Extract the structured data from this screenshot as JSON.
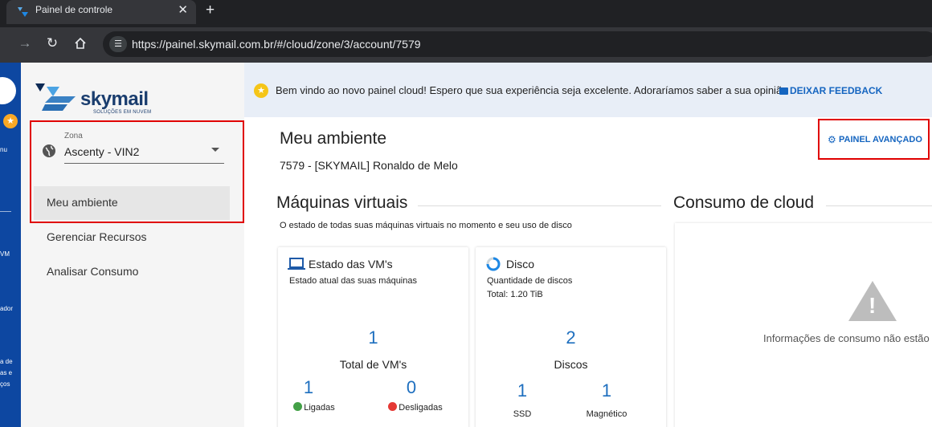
{
  "browser": {
    "tab_title": "Painel de controle",
    "close_glyph": "✕",
    "newtab_glyph": "+",
    "url": "https://painel.skymail.com.br/#/cloud/zone/3/account/7579"
  },
  "rail": {
    "items": [
      "nu",
      "VM",
      "ador",
      "a de",
      "as e",
      "ços"
    ]
  },
  "logo": {
    "word": "skymail",
    "tagline": "SOLUÇÕES EM NUVEM"
  },
  "zone": {
    "label": "Zona",
    "value": "Ascenty - VIN2"
  },
  "sidebar": {
    "items": [
      {
        "label": "Meu ambiente",
        "active": true
      },
      {
        "label": "Gerenciar Recursos"
      },
      {
        "label": "Analisar Consumo"
      }
    ]
  },
  "banner": {
    "message": "Bem vindo ao novo painel cloud! Espero que sua experiência seja excelente. Adoraríamos saber a sua opinião",
    "feedback_label": "DEIXAR FEEDBACK"
  },
  "main": {
    "title": "Meu ambiente",
    "account": "7579 - [SKYMAIL] Ronaldo de Melo",
    "advanced_button": "PAINEL AVANÇADO"
  },
  "vms_section": {
    "title": "Máquinas virtuais",
    "description": "O estado de todas suas máquinas virtuais no momento e seu uso de disco",
    "vm_card": {
      "title": "Estado das VM's",
      "subtitle": "Estado atual das suas máquinas",
      "total_value": "1",
      "total_label": "Total de VM's",
      "on_value": "1",
      "on_label": "Ligadas",
      "off_value": "0",
      "off_label": "Desligadas"
    },
    "disk_card": {
      "title": "Disco",
      "subtitle": "Quantidade de discos",
      "total_size": "Total: 1.20 TiB",
      "disks_value": "2",
      "disks_label": "Discos",
      "ssd_value": "1",
      "ssd_label": "SSD",
      "mag_value": "1",
      "mag_label": "Magnético"
    }
  },
  "consumo_section": {
    "title": "Consumo de cloud",
    "message": "Informações de consumo não estão d"
  },
  "colors": {
    "accent": "#1565c0",
    "highlight": "#e00000",
    "on": "#43a047",
    "off": "#e53935"
  }
}
